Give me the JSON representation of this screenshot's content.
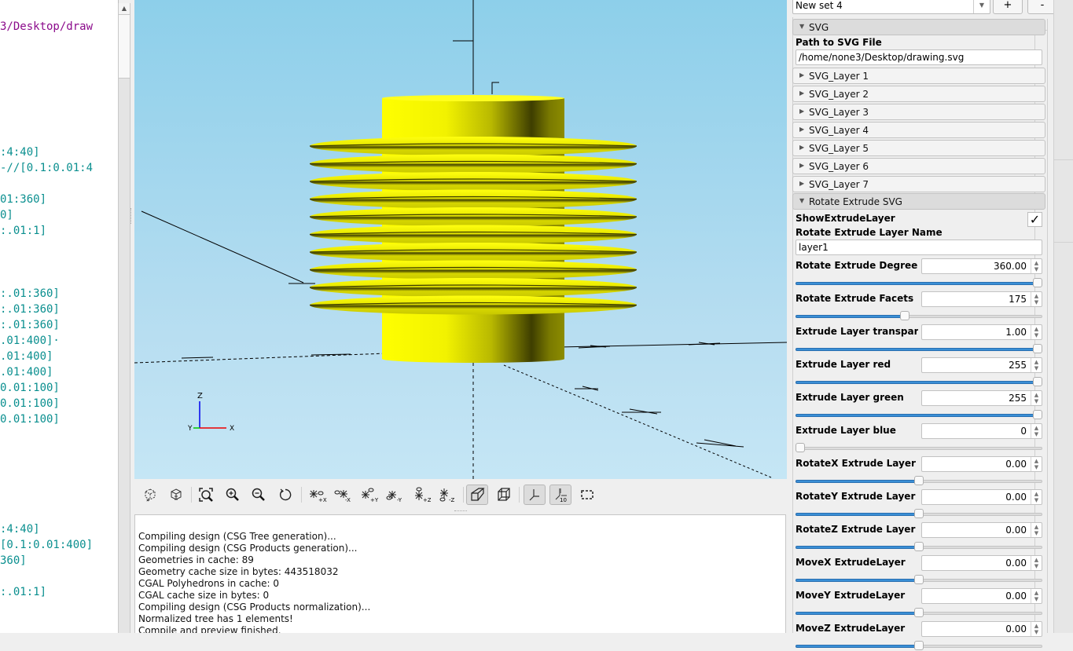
{
  "editor": {
    "lines": [
      {
        "text": "3/Desktop/draw",
        "kind": "str",
        "row": 1
      },
      {
        "text": ":4:40]",
        "kind": "num",
        "row": 9
      },
      {
        "text": "-//[0.1:0.01:4",
        "kind": "num",
        "row": 10
      },
      {
        "text": "01:360]",
        "kind": "num",
        "row": 12
      },
      {
        "text": "0]",
        "kind": "num",
        "row": 13
      },
      {
        "text": ":.01:1]",
        "kind": "num",
        "row": 14
      },
      {
        "text": ":.01:360]",
        "kind": "num",
        "row": 18
      },
      {
        "text": ":.01:360]",
        "kind": "num",
        "row": 19
      },
      {
        "text": ":.01:360]",
        "kind": "num",
        "row": 20
      },
      {
        "text": ".01:400]·",
        "kind": "num",
        "row": 21
      },
      {
        "text": ".01:400]",
        "kind": "num",
        "row": 22
      },
      {
        "text": ".01:400]",
        "kind": "num",
        "row": 23
      },
      {
        "text": "0.01:100]",
        "kind": "num",
        "row": 24
      },
      {
        "text": "0.01:100]",
        "kind": "num",
        "row": 25
      },
      {
        "text": "0.01:100]",
        "kind": "num",
        "row": 26
      },
      {
        "text": ":4:40]",
        "kind": "num",
        "row": 33
      },
      {
        "text": "[0.1:0.01:400]",
        "kind": "num",
        "row": 34
      },
      {
        "text": "360]",
        "kind": "num",
        "row": 35
      },
      {
        "text": ":.01:1]",
        "kind": "num",
        "row": 37
      }
    ]
  },
  "viewport": {
    "axes_labels": {
      "x": "X",
      "y": "Y",
      "z": "Z"
    },
    "model_color": "#ffff00",
    "axis_colors": {
      "x": "#ff0000",
      "y": "#00cc00",
      "z": "#0000ff"
    }
  },
  "toolbar": {
    "buttons": [
      {
        "name": "preview-button",
        "icon": "preview-cube-icon",
        "tooltip": "Preview"
      },
      {
        "name": "render-button",
        "icon": "render-cube-icon",
        "tooltip": "Render"
      },
      {
        "name": "view-all-button",
        "icon": "zoom-all-icon",
        "tooltip": "View All"
      },
      {
        "name": "zoom-in-button",
        "icon": "zoom-in-icon",
        "tooltip": "Zoom In"
      },
      {
        "name": "zoom-out-button",
        "icon": "zoom-out-icon",
        "tooltip": "Zoom Out"
      },
      {
        "name": "reset-view-button",
        "icon": "reset-view-icon",
        "tooltip": "Reset View"
      },
      {
        "name": "view-right-button",
        "icon": "view-right-icon",
        "label": "+X"
      },
      {
        "name": "view-left-button",
        "icon": "view-left-icon",
        "label": "-X"
      },
      {
        "name": "view-back-button",
        "icon": "view-back-icon",
        "label": "+Y"
      },
      {
        "name": "view-front-button",
        "icon": "view-front-icon",
        "label": "-Y"
      },
      {
        "name": "view-top-button",
        "icon": "view-top-icon",
        "label": "+Z"
      },
      {
        "name": "view-bottom-button",
        "icon": "view-bottom-icon",
        "label": "-Z"
      },
      {
        "name": "perspective-button",
        "icon": "perspective-icon",
        "active": true
      },
      {
        "name": "orthogonal-button",
        "icon": "orthogonal-icon",
        "active": false
      },
      {
        "name": "show-axes-button",
        "icon": "axes-icon",
        "active": true
      },
      {
        "name": "show-scale-button",
        "icon": "scale-markers-icon",
        "active": true,
        "label": "10"
      },
      {
        "name": "show-edges-button",
        "icon": "edges-icon",
        "active": false
      }
    ]
  },
  "console": {
    "lines": [
      "",
      "Compiling design (CSG Tree generation)...",
      "Compiling design (CSG Products generation)...",
      "Geometries in cache: 89",
      "Geometry cache size in bytes: 443518032",
      "CGAL Polyhedrons in cache: 0",
      "CGAL cache size in bytes: 0",
      "Compiling design (CSG Products normalization)...",
      "Normalized tree has 1 elements!",
      "Compile and preview finished."
    ]
  },
  "customizer": {
    "preset": {
      "selected": "New set 4",
      "add_label": "+",
      "remove_label": "-"
    },
    "svg_group": {
      "title": "SVG",
      "path_label": "Path to SVG File",
      "path_value": "/home/none3/Desktop/drawing.svg",
      "layers": [
        "SVG_Layer 1",
        "SVG_Layer 2",
        "SVG_Layer 3",
        "SVG_Layer 4",
        "SVG_Layer 5",
        "SVG_Layer 6",
        "SVG_Layer 7"
      ]
    },
    "extrude_group": {
      "title": "Rotate Extrude SVG",
      "show_label": "ShowExtrudeLayer",
      "show_checked": true,
      "check_glyph": "✓",
      "name_label": "Rotate Extrude Layer Name",
      "name_value": "layer1",
      "params": [
        {
          "label": "Rotate Extrude Degree",
          "value": "360.00",
          "fraction": 1.0
        },
        {
          "label": "Rotate Extrude Facets",
          "value": "175",
          "fraction": 0.44
        },
        {
          "label": "Extrude Layer transpar",
          "value": "1.00",
          "fraction": 1.0
        },
        {
          "label": "Extrude Layer red",
          "value": "255",
          "fraction": 1.0
        },
        {
          "label": "Extrude Layer green",
          "value": "255",
          "fraction": 1.0
        },
        {
          "label": "Extrude Layer blue",
          "value": "0",
          "fraction": 0.0
        },
        {
          "label": "RotateX Extrude Layer",
          "value": "0.00",
          "fraction": 0.5
        },
        {
          "label": "RotateY Extrude Layer",
          "value": "0.00",
          "fraction": 0.5
        },
        {
          "label": "RotateZ Extrude Layer",
          "value": "0.00",
          "fraction": 0.5
        },
        {
          "label": "MoveX ExtrudeLayer",
          "value": "0.00",
          "fraction": 0.5
        },
        {
          "label": "MoveY ExtrudeLayer",
          "value": "0.00",
          "fraction": 0.5
        },
        {
          "label": "MoveZ ExtrudeLayer",
          "value": "0.00",
          "fraction": 0.5
        }
      ]
    }
  }
}
